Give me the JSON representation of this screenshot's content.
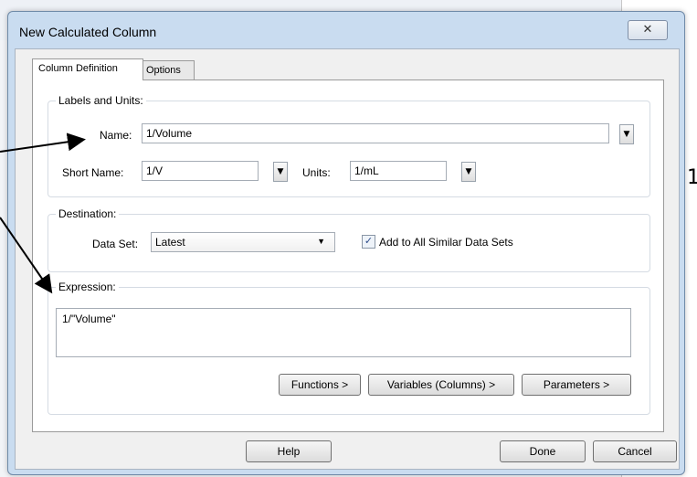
{
  "dialog": {
    "title": "New Calculated Column",
    "close_icon": "close-icon"
  },
  "tabs": [
    {
      "label": "Column Definition",
      "active": true
    },
    {
      "label": "Options",
      "active": false
    }
  ],
  "labels_units": {
    "group_label": "Labels and Units:",
    "name_label": "Name:",
    "name_value": "1/Volume",
    "short_name_label": "Short Name:",
    "short_name_value": "1/V",
    "units_label": "Units:",
    "units_value": "1/mL"
  },
  "destination": {
    "group_label": "Destination:",
    "data_set_label": "Data Set:",
    "data_set_value": "Latest",
    "add_all_checked": true,
    "add_all_label": "Add to All Similar Data Sets"
  },
  "expression": {
    "group_label": "Expression:",
    "value": "1/\"Volume\"",
    "functions_button": "Functions >",
    "variables_button": "Variables (Columns) >",
    "parameters_button": "Parameters >"
  },
  "footer": {
    "help_button": "Help",
    "done_button": "Done",
    "cancel_button": "Cancel"
  },
  "background": {
    "right_edge_text": "1"
  },
  "colors": {
    "dialog_frame": "#c9dcf0",
    "client_bg": "#f0f0f0",
    "arrow": "#000000"
  }
}
